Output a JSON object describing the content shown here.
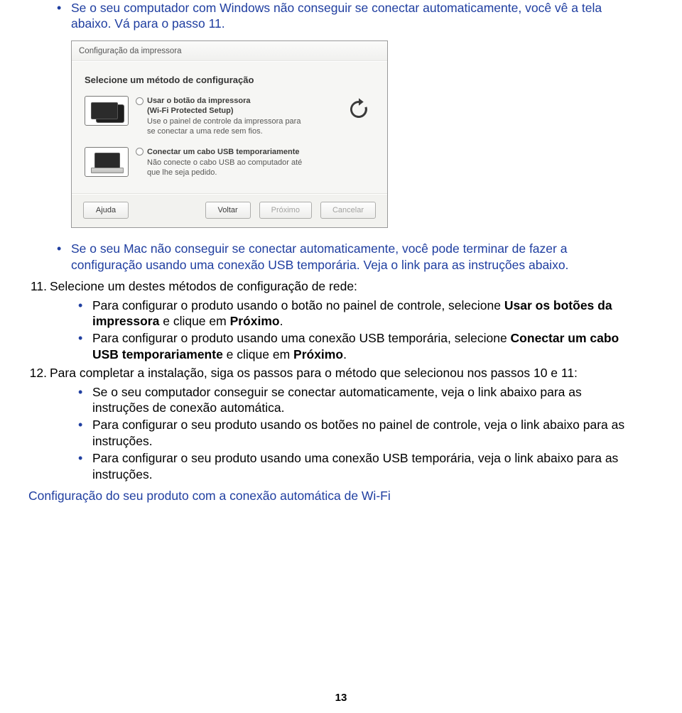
{
  "bullet_top": {
    "text_before": "Se o seu computador com Windows não conseguir se conectar automaticamente, você vê a tela abaixo. Vá para o passo 11."
  },
  "dialog": {
    "title": "Configuração da impressora",
    "heading": "Selecione um método de configuração",
    "option1": {
      "title_line1": "Usar o botão da impressora",
      "title_line2": "(Wi-Fi Protected Setup)",
      "desc": "Use o painel de controle da impressora para se conectar a uma rede sem fios."
    },
    "option2": {
      "title_line1": "Conectar um cabo USB temporariamente",
      "desc": "Não conecte o cabo USB ao computador até que lhe seja pedido."
    },
    "buttons": {
      "help": "Ajuda",
      "back": "Voltar",
      "next": "Próximo",
      "cancel": "Cancelar"
    }
  },
  "bullet_mac": {
    "text": "Se o seu Mac não conseguir se conectar automaticamente, você pode terminar de fazer a configuração usando uma conexão USB temporária. Veja o link para as instruções abaixo."
  },
  "step11": {
    "num": "11.",
    "text": "Selecione um destes métodos de configuração de rede:",
    "sub1_pre": "Para configurar o produto usando o botão no painel de controle, selecione ",
    "sub1_bold": "Usar os botões da impressora",
    "sub1_mid": " e clique em ",
    "sub1_bold2": "Próximo",
    "sub1_post": ".",
    "sub2_pre": "Para configurar o produto usando uma conexão USB temporária, selecione ",
    "sub2_bold": "Conectar um cabo USB temporariamente",
    "sub2_mid": " e clique em ",
    "sub2_bold2": "Próximo",
    "sub2_post": "."
  },
  "step12": {
    "num": "12.",
    "text": "Para completar a instalação, siga os passos para o método que selecionou nos passos 10 e 11:",
    "sub1": "Se o seu computador conseguir se conectar automaticamente, veja o link abaixo para as instruções de conexão automática.",
    "sub2": "Para configurar o seu produto usando os botões no painel de controle, veja o link abaixo para as instruções.",
    "sub3": "Para configurar o seu produto usando uma conexão USB temporária, veja o link abaixo para as instruções."
  },
  "link_text": "Configuração do seu produto com a conexão automática de Wi-Fi",
  "page_number": "13"
}
